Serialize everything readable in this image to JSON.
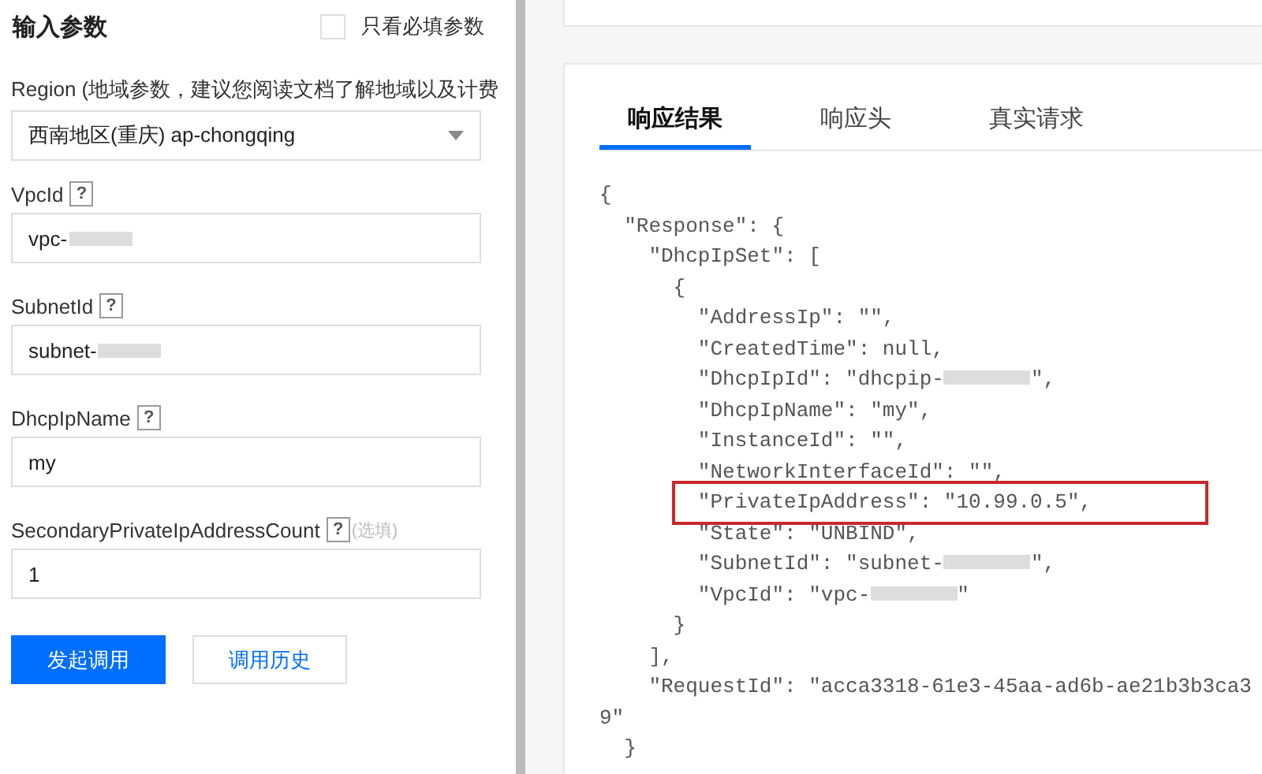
{
  "form": {
    "title": "输入参数",
    "required_only": {
      "label": "只看必填参数",
      "checked": false
    },
    "fields": [
      {
        "kind": "select",
        "label": "Region (地域参数，建议您阅读文档了解地域以及计费",
        "value": "西南地区(重庆) ap-chongqing"
      },
      {
        "kind": "input",
        "label": "VpcId",
        "help": "?",
        "value": "vpc-",
        "redacted": true
      },
      {
        "kind": "input",
        "label": "SubnetId",
        "help": "?",
        "value": "subnet-",
        "redacted": true
      },
      {
        "kind": "input",
        "label": "DhcpIpName",
        "help": "?",
        "value": "my",
        "redacted": false
      },
      {
        "kind": "input",
        "label": "SecondaryPrivateIpAddressCount",
        "help": "?",
        "optional": "(选填)",
        "value": "1",
        "redacted": false
      }
    ],
    "buttons": [
      {
        "label": "发起调用",
        "primary": true
      },
      {
        "label": "调用历史",
        "primary": false
      }
    ]
  },
  "response": {
    "tabs": [
      {
        "label": "响应结果",
        "selected": true
      },
      {
        "label": "响应头",
        "selected": false
      },
      {
        "label": "真实请求",
        "selected": false
      }
    ],
    "code_lines": [
      {
        "text": "{"
      },
      {
        "text": "  \"Response\": {"
      },
      {
        "text": "    \"DhcpIpSet\": ["
      },
      {
        "text": "      {"
      },
      {
        "text": "        \"AddressIp\": \"\","
      },
      {
        "text": "        \"CreatedTime\": null,"
      },
      {
        "text": "        \"DhcpIpId\": \"dhcpip-",
        "redacted": true,
        "after": "\","
      },
      {
        "text": "        \"DhcpIpName\": \"my\","
      },
      {
        "text": "        \"InstanceId\": \"\","
      },
      {
        "text": "        \"NetworkInterfaceId\": \"\","
      },
      {
        "text": "        \"PrivateIpAddress\": \"10.99.0.5\",",
        "highlighted": true
      },
      {
        "text": "        \"State\": \"UNBIND\","
      },
      {
        "text": "        \"SubnetId\": \"subnet-",
        "redacted": true,
        "after": "\","
      },
      {
        "text": "        \"VpcId\": \"vpc-",
        "redacted": true,
        "after": "\""
      },
      {
        "text": "      }"
      },
      {
        "text": "    ],"
      },
      {
        "text": "    \"RequestId\": \"acca3318-61e3-45aa-ad6b-ae21b3b3ca3"
      },
      {
        "text": "9\""
      },
      {
        "text": "  }"
      }
    ]
  }
}
